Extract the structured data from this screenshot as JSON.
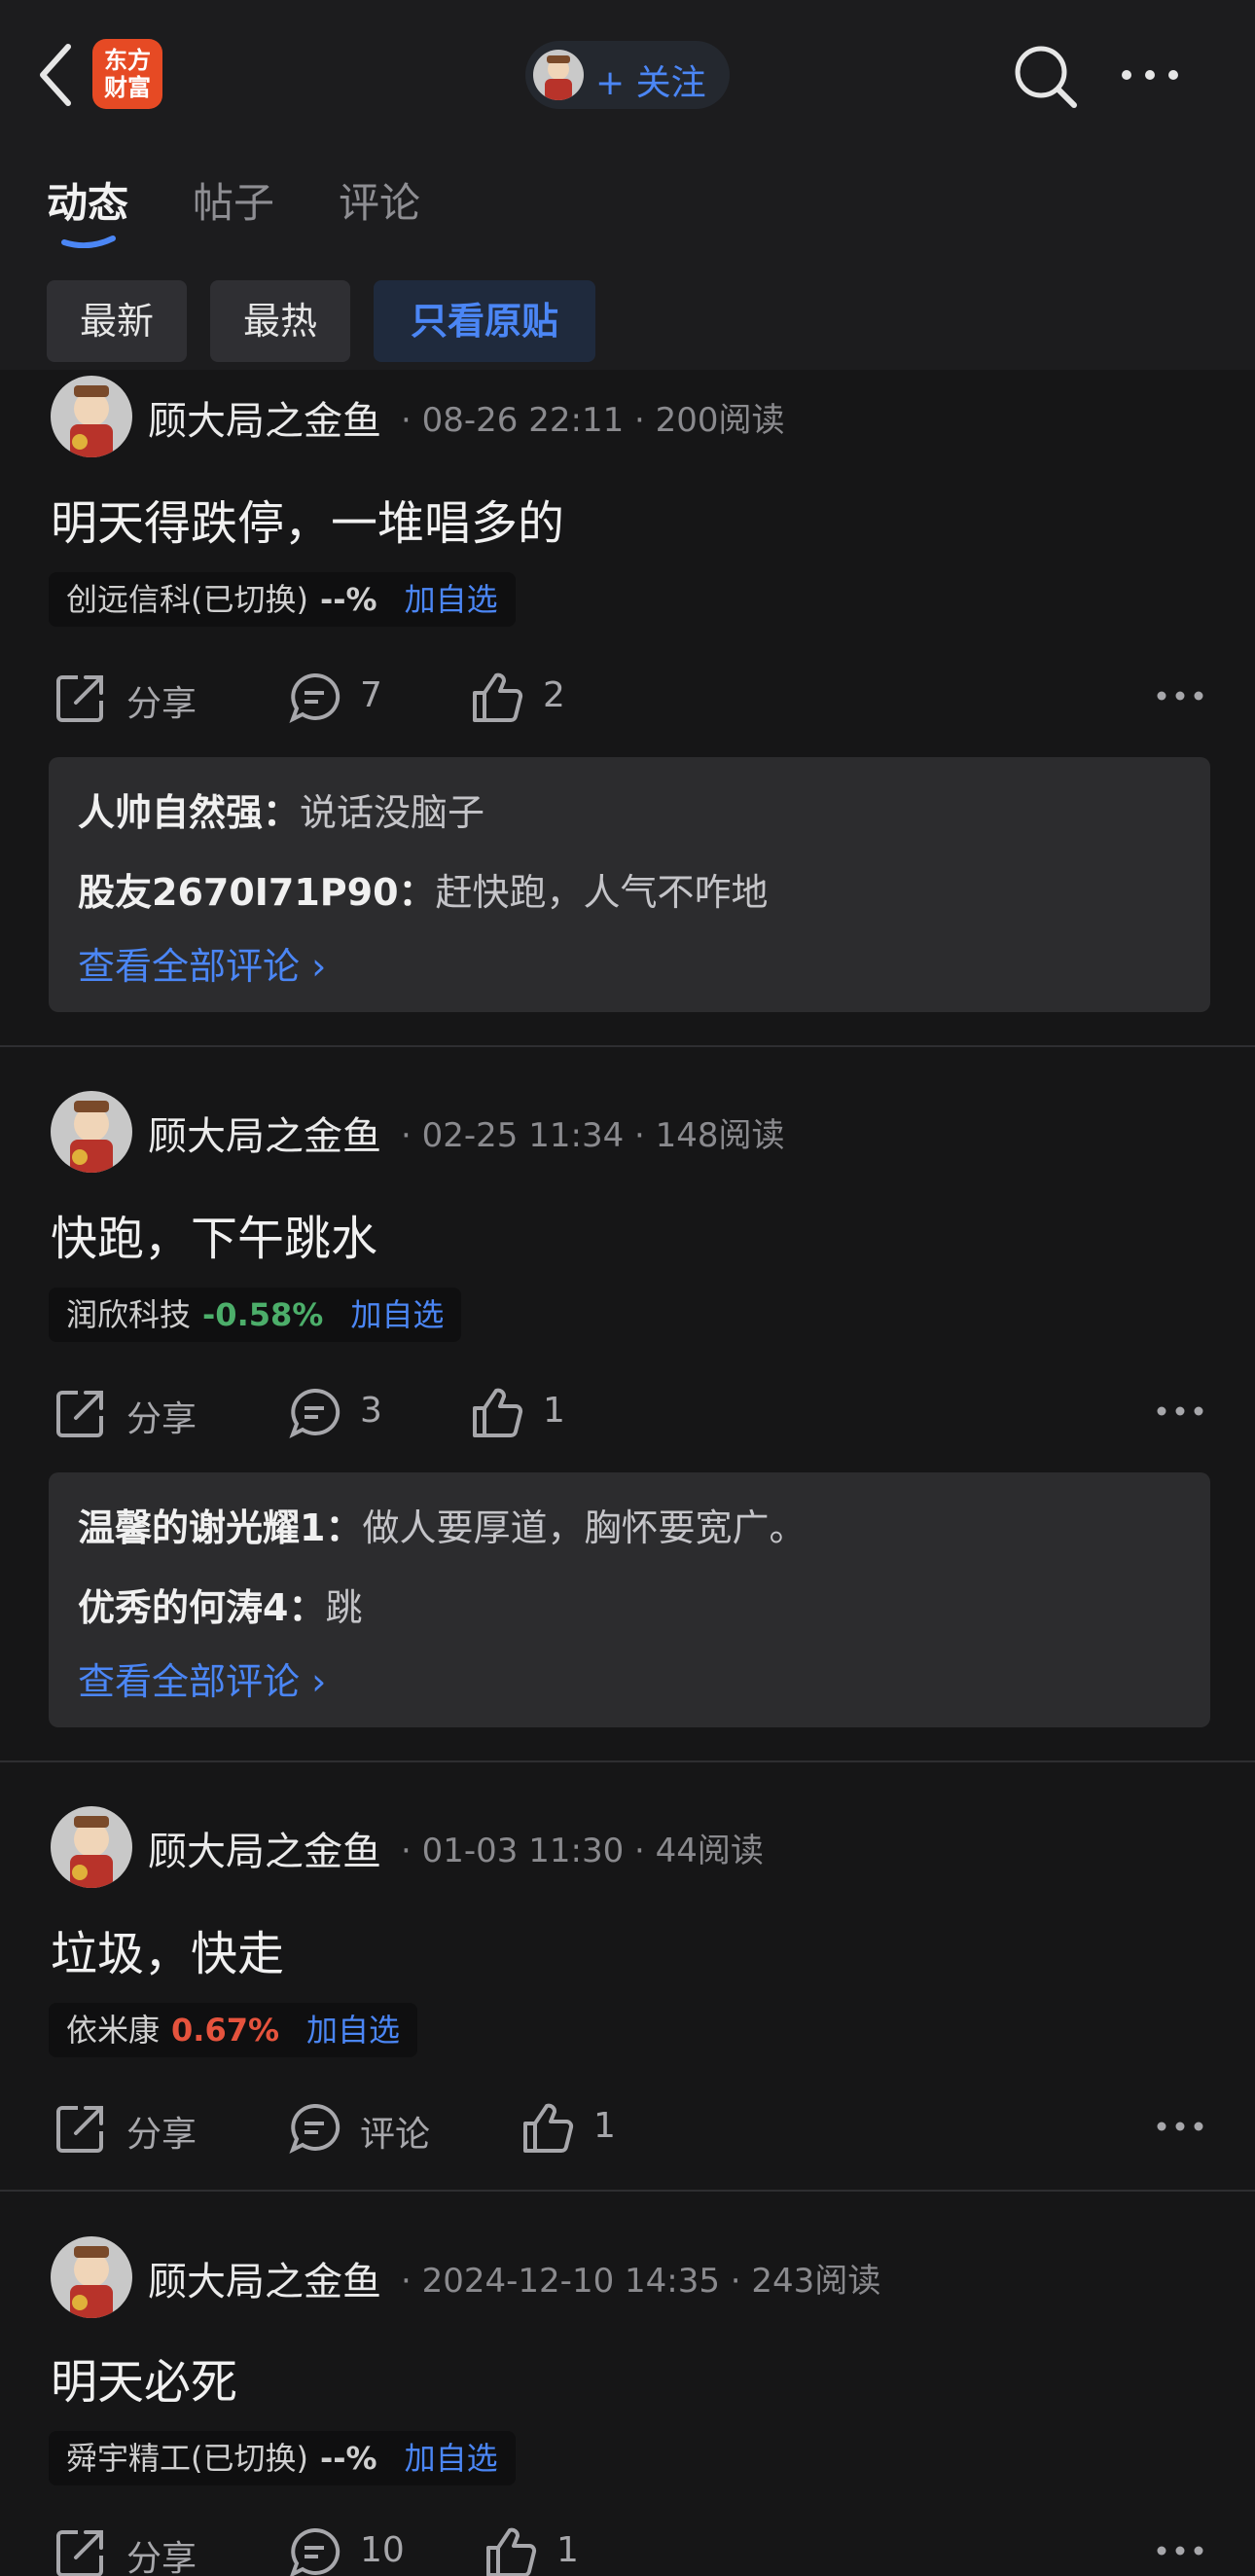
{
  "header": {
    "logo_text_line1": "东方",
    "logo_text_line2": "财富",
    "follow_label": "+ 关注",
    "colors": {
      "accent": "#4b86f5",
      "logo": "#e64a24",
      "up": "#e5533d",
      "down": "#4cae6a"
    }
  },
  "tabs": [
    {
      "label": "动态",
      "active": true
    },
    {
      "label": "帖子",
      "active": false
    },
    {
      "label": "评论",
      "active": false
    }
  ],
  "filters": [
    {
      "label": "最新",
      "selected": false
    },
    {
      "label": "最热",
      "selected": false
    },
    {
      "label": "只看原贴",
      "selected": true
    }
  ],
  "posts": [
    {
      "author": "顾大局之金鱼",
      "meta": "· 08-26 22:11 · 200阅读",
      "content": "明天得跌停，一堆唱多的",
      "stock": {
        "name": "创远信科(已切换)",
        "change": "--%",
        "add": "加自选"
      },
      "share": "分享",
      "comments": "7",
      "likes": "2",
      "replies": [
        {
          "user": "人帅自然强：",
          "text": "说话没脑子"
        },
        {
          "user": "股友2670I71P90：",
          "text": "赶快跑，人气不咋地"
        }
      ],
      "view_all": "查看全部评论 ›"
    },
    {
      "author": "顾大局之金鱼",
      "meta": "· 02-25 11:34 · 148阅读",
      "content": "快跑，下午跳水",
      "stock": {
        "name": "润欣科技",
        "change": "-0.58%",
        "add": "加自选"
      },
      "share": "分享",
      "comments": "3",
      "likes": "1",
      "replies": [
        {
          "user": "温馨的谢光耀1：",
          "text": "做人要厚道，胸怀要宽广。"
        },
        {
          "user": "优秀的何涛4：",
          "text": "跳"
        }
      ],
      "view_all": "查看全部评论 ›"
    },
    {
      "author": "顾大局之金鱼",
      "meta": "· 01-03 11:30 · 44阅读",
      "content": "垃圾，快走",
      "stock": {
        "name": "依米康",
        "change": "0.67%",
        "add": "加自选"
      },
      "share": "分享",
      "comments": "评论",
      "likes": "1"
    },
    {
      "author": "顾大局之金鱼",
      "meta": "· 2024-12-10 14:35 · 243阅读",
      "content": "明天必死",
      "stock": {
        "name": "舜宇精工(已切换)",
        "change": "--%",
        "add": "加自选"
      },
      "share": "分享",
      "comments": "10",
      "likes": "1"
    }
  ]
}
